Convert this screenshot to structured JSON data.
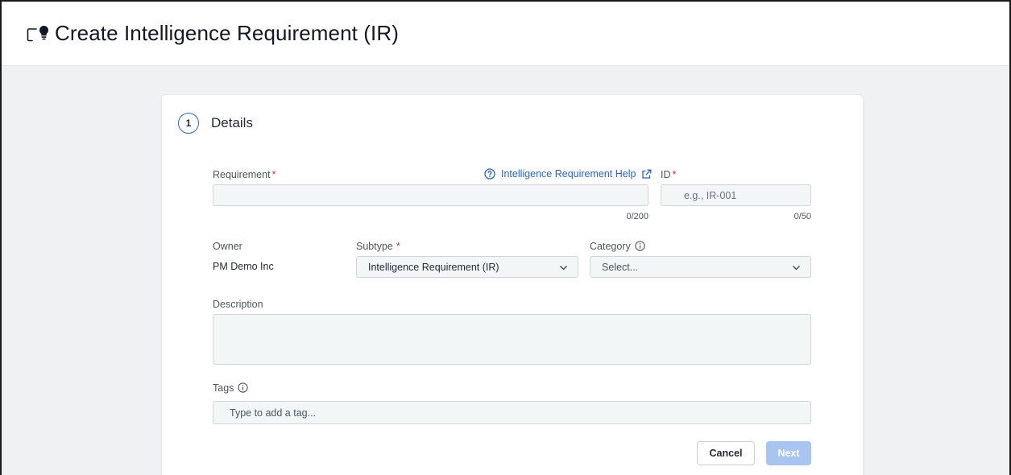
{
  "page": {
    "title": "Create Intelligence Requirement (IR)",
    "header_icon": "lightbulb-screen-icon"
  },
  "step": {
    "number": "1",
    "title": "Details"
  },
  "form": {
    "requirement": {
      "label": "Requirement",
      "required_mark": "*",
      "value": "",
      "counter": "0/200"
    },
    "help_link": {
      "label": "Intelligence Requirement Help",
      "icon": "question-circle-icon",
      "trailing_icon": "external-link-icon"
    },
    "id": {
      "label": "ID",
      "required_mark": "*",
      "placeholder": "e.g., IR-001",
      "counter": "0/50"
    },
    "owner": {
      "label": "Owner",
      "value": "PM Demo Inc"
    },
    "subtype": {
      "label": "Subtype",
      "required_mark": "*",
      "selected": "Intelligence Requirement (IR)"
    },
    "category": {
      "label": "Category",
      "placeholder": "Select..."
    },
    "description": {
      "label": "Description",
      "value": ""
    },
    "tags": {
      "label": "Tags",
      "placeholder": "Type to add a tag..."
    }
  },
  "actions": {
    "cancel_label": "Cancel",
    "next_label": "Next"
  },
  "colors": {
    "accent": "#2563eb",
    "required": "#dc2626",
    "next_disabled": "#a8c4f3",
    "page_bg": "#f0f1f3"
  }
}
